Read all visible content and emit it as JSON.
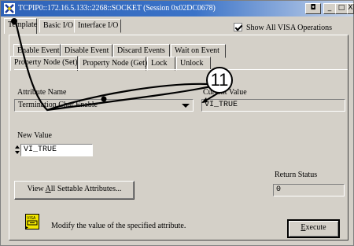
{
  "window": {
    "title": "TCPIP0::172.16.5.133::2268::SOCKET (Session 0x02DC0678)",
    "extra_button": "◘",
    "min_button": "_",
    "max_button": "□",
    "close_button": "X"
  },
  "tabs_top": [
    {
      "label": "Template"
    },
    {
      "label": "Basic I/O"
    },
    {
      "label": "Interface I/O"
    }
  ],
  "show_all_visa": {
    "label": "Show All VISA Operations",
    "checked": true
  },
  "tabs_row1": [
    {
      "label": "Enable Event"
    },
    {
      "label": "Disable Event"
    },
    {
      "label": "Discard Events"
    },
    {
      "label": "Wait on Event"
    }
  ],
  "tabs_row2": [
    {
      "label": "Property Node (Set)"
    },
    {
      "label": "Property Node (Get)"
    },
    {
      "label": "Lock"
    },
    {
      "label": "Unlock"
    }
  ],
  "attribute_name": {
    "label": "Attribute Name",
    "value": "Termination Char Enable"
  },
  "current_value": {
    "label": "Current Value",
    "value": "VI_TRUE"
  },
  "new_value": {
    "label": "New Value",
    "value": "VI_TRUE"
  },
  "view_settable": {
    "label_pre": "View ",
    "label_u": "A",
    "label_post": "ll Settable Attributes..."
  },
  "return_status": {
    "label": "Return Status",
    "value": "0"
  },
  "help": {
    "icon_text": "VISA",
    "text": "Modify the value of the specified attribute."
  },
  "execute": {
    "label_u": "E",
    "label_post": "xecute"
  },
  "callout": {
    "number": "11"
  }
}
